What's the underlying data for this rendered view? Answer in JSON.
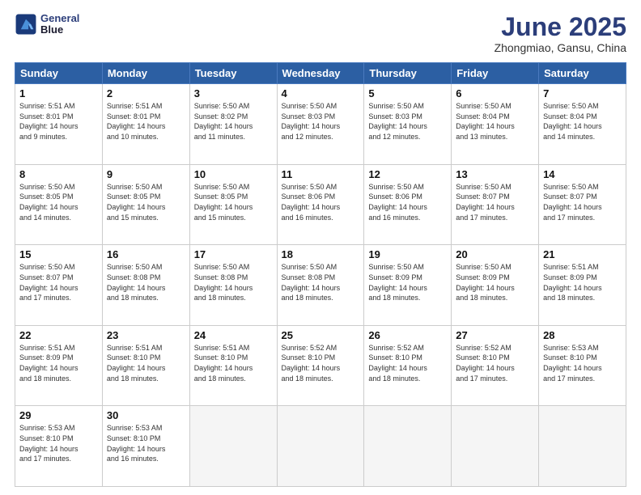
{
  "header": {
    "logo_line1": "General",
    "logo_line2": "Blue",
    "month_title": "June 2025",
    "location": "Zhongmiao, Gansu, China"
  },
  "days_of_week": [
    "Sunday",
    "Monday",
    "Tuesday",
    "Wednesday",
    "Thursday",
    "Friday",
    "Saturday"
  ],
  "weeks": [
    [
      {
        "day": "1",
        "info": "Sunrise: 5:51 AM\nSunset: 8:01 PM\nDaylight: 14 hours\nand 9 minutes."
      },
      {
        "day": "2",
        "info": "Sunrise: 5:51 AM\nSunset: 8:01 PM\nDaylight: 14 hours\nand 10 minutes."
      },
      {
        "day": "3",
        "info": "Sunrise: 5:50 AM\nSunset: 8:02 PM\nDaylight: 14 hours\nand 11 minutes."
      },
      {
        "day": "4",
        "info": "Sunrise: 5:50 AM\nSunset: 8:03 PM\nDaylight: 14 hours\nand 12 minutes."
      },
      {
        "day": "5",
        "info": "Sunrise: 5:50 AM\nSunset: 8:03 PM\nDaylight: 14 hours\nand 12 minutes."
      },
      {
        "day": "6",
        "info": "Sunrise: 5:50 AM\nSunset: 8:04 PM\nDaylight: 14 hours\nand 13 minutes."
      },
      {
        "day": "7",
        "info": "Sunrise: 5:50 AM\nSunset: 8:04 PM\nDaylight: 14 hours\nand 14 minutes."
      }
    ],
    [
      {
        "day": "8",
        "info": "Sunrise: 5:50 AM\nSunset: 8:05 PM\nDaylight: 14 hours\nand 14 minutes."
      },
      {
        "day": "9",
        "info": "Sunrise: 5:50 AM\nSunset: 8:05 PM\nDaylight: 14 hours\nand 15 minutes."
      },
      {
        "day": "10",
        "info": "Sunrise: 5:50 AM\nSunset: 8:05 PM\nDaylight: 14 hours\nand 15 minutes."
      },
      {
        "day": "11",
        "info": "Sunrise: 5:50 AM\nSunset: 8:06 PM\nDaylight: 14 hours\nand 16 minutes."
      },
      {
        "day": "12",
        "info": "Sunrise: 5:50 AM\nSunset: 8:06 PM\nDaylight: 14 hours\nand 16 minutes."
      },
      {
        "day": "13",
        "info": "Sunrise: 5:50 AM\nSunset: 8:07 PM\nDaylight: 14 hours\nand 17 minutes."
      },
      {
        "day": "14",
        "info": "Sunrise: 5:50 AM\nSunset: 8:07 PM\nDaylight: 14 hours\nand 17 minutes."
      }
    ],
    [
      {
        "day": "15",
        "info": "Sunrise: 5:50 AM\nSunset: 8:07 PM\nDaylight: 14 hours\nand 17 minutes."
      },
      {
        "day": "16",
        "info": "Sunrise: 5:50 AM\nSunset: 8:08 PM\nDaylight: 14 hours\nand 18 minutes."
      },
      {
        "day": "17",
        "info": "Sunrise: 5:50 AM\nSunset: 8:08 PM\nDaylight: 14 hours\nand 18 minutes."
      },
      {
        "day": "18",
        "info": "Sunrise: 5:50 AM\nSunset: 8:08 PM\nDaylight: 14 hours\nand 18 minutes."
      },
      {
        "day": "19",
        "info": "Sunrise: 5:50 AM\nSunset: 8:09 PM\nDaylight: 14 hours\nand 18 minutes."
      },
      {
        "day": "20",
        "info": "Sunrise: 5:50 AM\nSunset: 8:09 PM\nDaylight: 14 hours\nand 18 minutes."
      },
      {
        "day": "21",
        "info": "Sunrise: 5:51 AM\nSunset: 8:09 PM\nDaylight: 14 hours\nand 18 minutes."
      }
    ],
    [
      {
        "day": "22",
        "info": "Sunrise: 5:51 AM\nSunset: 8:09 PM\nDaylight: 14 hours\nand 18 minutes."
      },
      {
        "day": "23",
        "info": "Sunrise: 5:51 AM\nSunset: 8:10 PM\nDaylight: 14 hours\nand 18 minutes."
      },
      {
        "day": "24",
        "info": "Sunrise: 5:51 AM\nSunset: 8:10 PM\nDaylight: 14 hours\nand 18 minutes."
      },
      {
        "day": "25",
        "info": "Sunrise: 5:52 AM\nSunset: 8:10 PM\nDaylight: 14 hours\nand 18 minutes."
      },
      {
        "day": "26",
        "info": "Sunrise: 5:52 AM\nSunset: 8:10 PM\nDaylight: 14 hours\nand 18 minutes."
      },
      {
        "day": "27",
        "info": "Sunrise: 5:52 AM\nSunset: 8:10 PM\nDaylight: 14 hours\nand 17 minutes."
      },
      {
        "day": "28",
        "info": "Sunrise: 5:53 AM\nSunset: 8:10 PM\nDaylight: 14 hours\nand 17 minutes."
      }
    ],
    [
      {
        "day": "29",
        "info": "Sunrise: 5:53 AM\nSunset: 8:10 PM\nDaylight: 14 hours\nand 17 minutes."
      },
      {
        "day": "30",
        "info": "Sunrise: 5:53 AM\nSunset: 8:10 PM\nDaylight: 14 hours\nand 16 minutes."
      },
      {
        "day": "",
        "info": ""
      },
      {
        "day": "",
        "info": ""
      },
      {
        "day": "",
        "info": ""
      },
      {
        "day": "",
        "info": ""
      },
      {
        "day": "",
        "info": ""
      }
    ]
  ]
}
